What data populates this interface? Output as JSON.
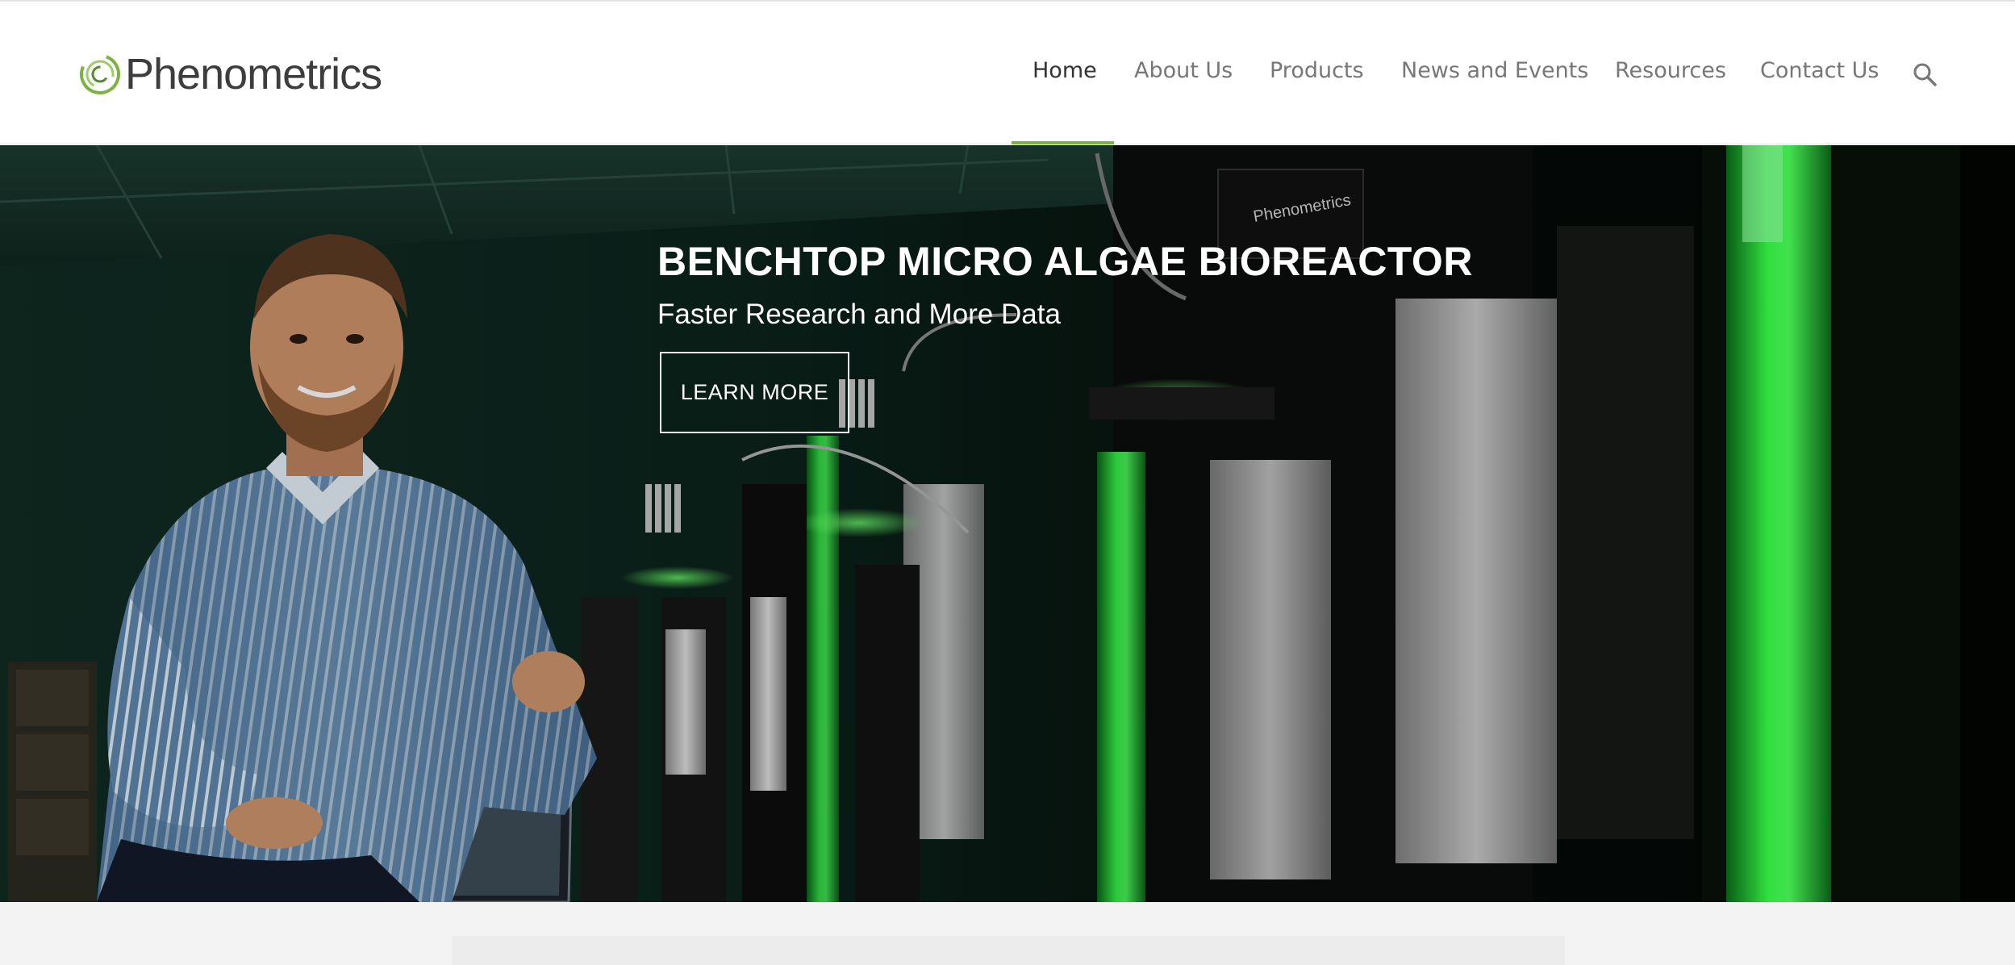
{
  "header": {
    "logo_text": "Phenometrics",
    "logo_icon": "phenometrics-swirl-logo",
    "accent_color": "#7cb342"
  },
  "nav": {
    "items": [
      {
        "label": "Home",
        "active": true
      },
      {
        "label": "About Us"
      },
      {
        "label": "Products"
      },
      {
        "label": "News and Events"
      },
      {
        "label": "Resources"
      },
      {
        "label": "Contact Us"
      }
    ],
    "search_icon": "search-icon"
  },
  "hero": {
    "title": "BENCHTOP MICRO ALGAE BIOREACTOR",
    "subtitle": "Faster Research and More Data",
    "button_label": "LEARN MORE",
    "device_brand": "Phenometrics"
  }
}
